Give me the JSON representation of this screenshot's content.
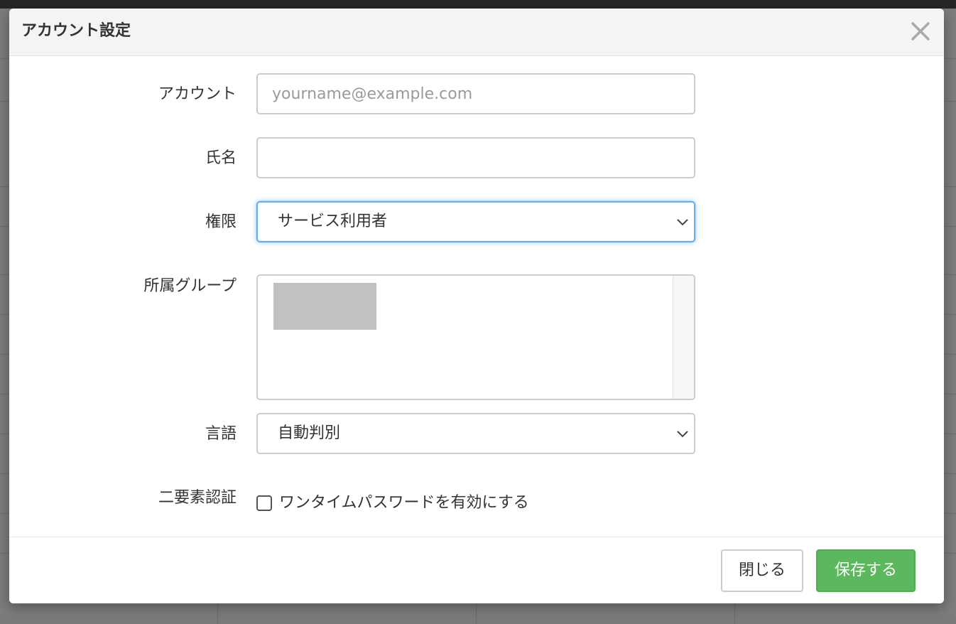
{
  "colors": {
    "primary_button": "#5cb85c",
    "focus_ring": "#66afe9",
    "header_background": "#f4f4f4"
  },
  "modal": {
    "title": "アカウント設定",
    "close_icon": "close-icon"
  },
  "form": {
    "account": {
      "label": "アカウント",
      "value": "",
      "placeholder": "yourname@example.com"
    },
    "full_name": {
      "label": "氏名",
      "value": "",
      "placeholder": ""
    },
    "role": {
      "label": "権限",
      "selected": "サービス利用者",
      "icon": "chevron-down-icon"
    },
    "groups": {
      "label": "所属グループ"
    },
    "language": {
      "label": "言語",
      "selected": "自動判別",
      "icon": "chevron-down-icon"
    },
    "two_factor": {
      "label": "二要素認証",
      "checkbox_label": "ワンタイムパスワードを有効にする",
      "checked": false
    }
  },
  "footer": {
    "close_label": "閉じる",
    "save_label": "保存する"
  }
}
